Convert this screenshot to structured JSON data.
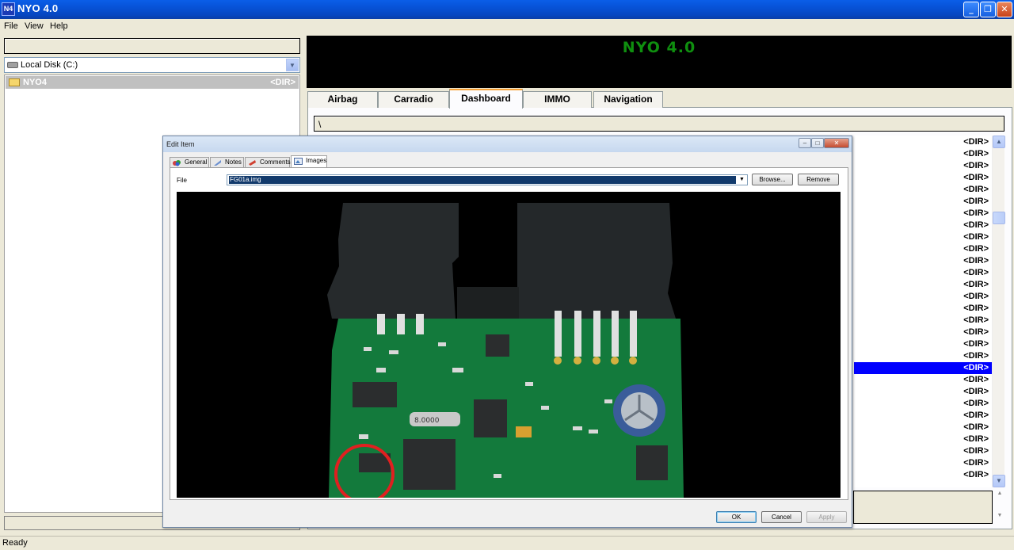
{
  "window": {
    "title": "NYO 4.0",
    "icon_label": "N4",
    "controls": {
      "minimize": "_",
      "maximize": "❐",
      "close": "✕"
    }
  },
  "menu": [
    "File",
    "View",
    "Help"
  ],
  "left_panel": {
    "drive": "Local Disk (C:)",
    "files": [
      {
        "name": "NYO4",
        "type": "<DIR>"
      }
    ]
  },
  "banner": {
    "title": "NYO 4.0"
  },
  "tabs": [
    {
      "label": "Airbag",
      "active": false
    },
    {
      "label": "Carradio",
      "active": false
    },
    {
      "label": "Dashboard",
      "active": true
    },
    {
      "label": "IMMO",
      "active": false
    },
    {
      "label": "Navigation",
      "active": false
    }
  ],
  "path": "\\",
  "dir_list": {
    "label": "<DIR>",
    "selected_index": 19
  },
  "status": "Ready",
  "dialog": {
    "title": "Edit Item",
    "tabs": [
      "General",
      "Notes",
      "Comments",
      "Images"
    ],
    "active_tab": "Images",
    "file_label": "File",
    "file_value": "FG01a.img",
    "browse_label": "Browse...",
    "remove_label": "Remove",
    "ok_label": "OK",
    "cancel_label": "Cancel",
    "apply_label": "Apply",
    "image": {
      "subject": "PCB photo",
      "chip_label": "8.0000"
    }
  },
  "colors": {
    "banner_text": "#0f8f0f",
    "selection": "#0000ff",
    "titlebar": "#0752d6",
    "active_tab_accent": "#f7a034"
  }
}
